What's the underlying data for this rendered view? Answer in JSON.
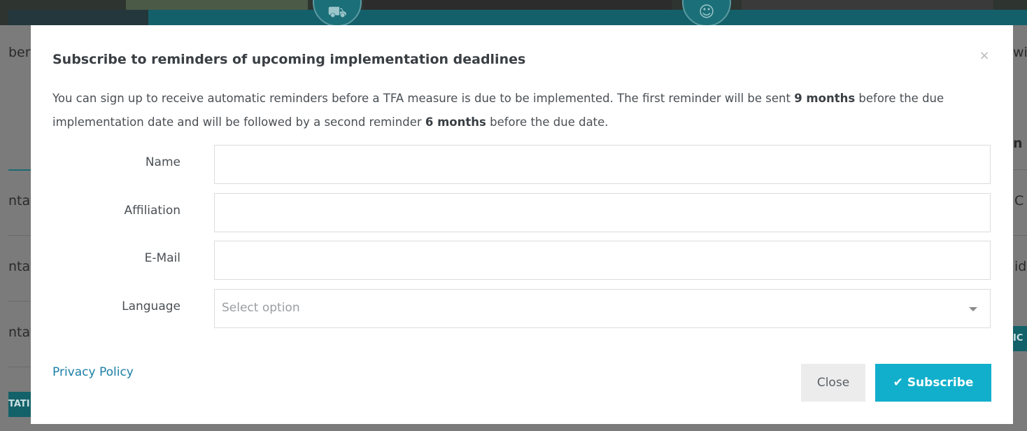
{
  "modal": {
    "title": "Subscribe to reminders of upcoming implementation deadlines",
    "close_x": "×",
    "description": {
      "part1": "You can sign up to receive automatic reminders before a TFA measure is due to be implemented. The first reminder will be sent ",
      "bold1": "9 months",
      "part2": " before the due implementation date and will be followed by a second reminder ",
      "bold2": "6 months",
      "part3": " before the due date."
    },
    "form": {
      "name_label": "Name",
      "name_value": "",
      "affiliation_label": "Affiliation",
      "affiliation_value": "",
      "email_label": "E-Mail",
      "email_value": "",
      "language_label": "Language",
      "language_placeholder": "Select option"
    },
    "privacy_link": "Privacy Policy",
    "close_button": "Close",
    "subscribe_button": "Subscribe",
    "subscribe_icon": "✔"
  },
  "background": {
    "left_fragments": [
      "ber",
      "ntat",
      "ntat",
      "ntat",
      "TATI"
    ],
    "right_fragments": [
      "wi",
      "n",
      "C",
      "id",
      "IC"
    ]
  },
  "colors": {
    "accent": "#11afcb",
    "link": "#1b7fa6",
    "close_button_bg": "#ececec"
  }
}
